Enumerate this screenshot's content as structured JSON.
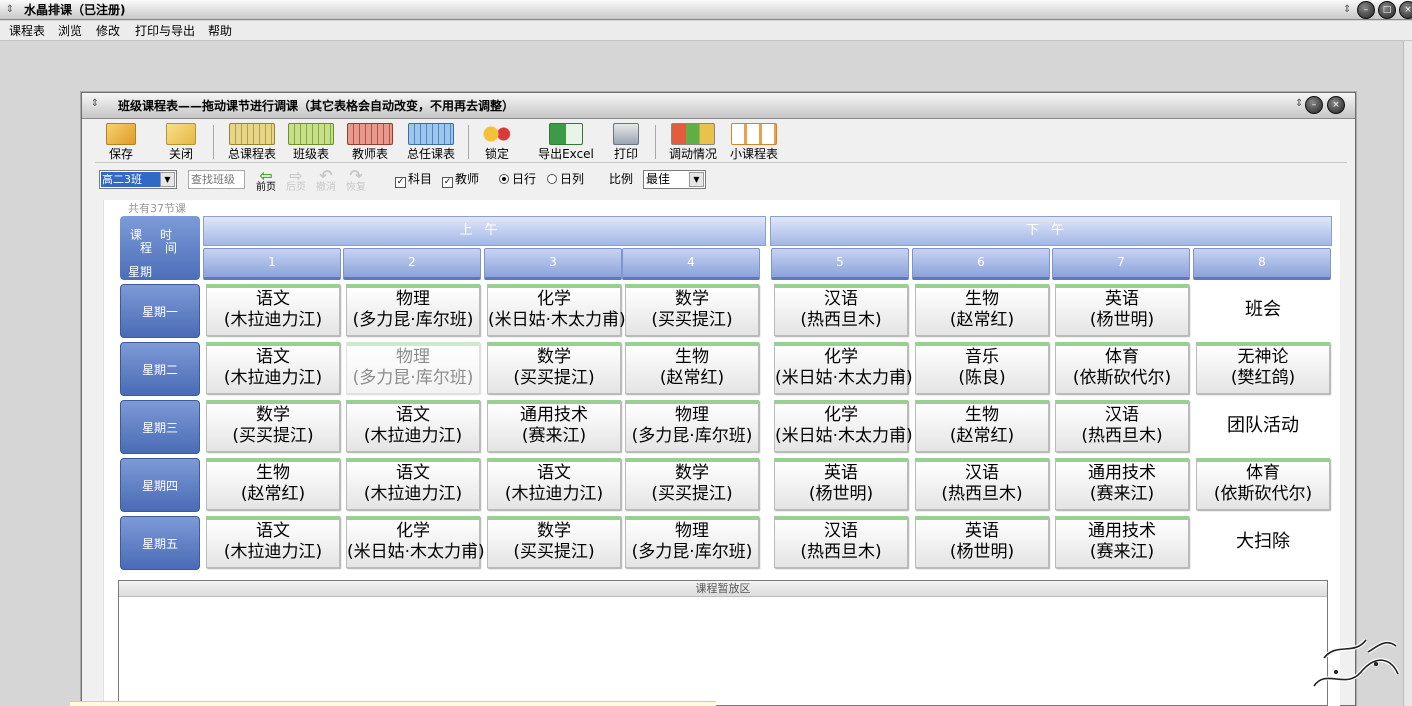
{
  "app": {
    "title": "水晶排课（已注册)"
  },
  "menu": [
    "课程表",
    "浏览",
    "修改",
    "打印与导出",
    "帮助"
  ],
  "window": {
    "title": "班级课程表——拖动课节进行调课（其它表格会自动改变，不用再去调整）"
  },
  "toolbar": {
    "save": "保存",
    "close": "关闭",
    "master": "总课程表",
    "class": "班级表",
    "teacher": "教师表",
    "head": "总任课表",
    "lock": "锁定",
    "excel": "导出Excel",
    "print": "打印",
    "adjust": "调动情况",
    "mini": "小课程表"
  },
  "options": {
    "class_value": "高二3班",
    "search_placeholder": "查找班级",
    "nav": [
      "前页",
      "后页",
      "撤消",
      "恢复"
    ],
    "chk_subject": "科目",
    "chk_teacher": "教师",
    "radio_row": "日行",
    "radio_col": "日列",
    "scale_label": "比例",
    "scale_value": "最佳"
  },
  "schedule": {
    "count": "共有37节课",
    "corner": {
      "a": "课",
      "b": "时",
      "c": "程",
      "d": "间",
      "e": "星期"
    },
    "morning": "上午",
    "afternoon": "下午",
    "periods": [
      "1",
      "2",
      "3",
      "4",
      "5",
      "6",
      "7",
      "8"
    ],
    "days": [
      {
        "name": "星期一",
        "lessons": [
          {
            "s": "语文",
            "t": "(木拉迪力江)"
          },
          {
            "s": "物理",
            "t": "(多力昆·库尔班)"
          },
          {
            "s": "化学",
            "t": "(米日姑·木太力甫)"
          },
          {
            "s": "数学",
            "t": "(买买提江)"
          },
          {
            "s": "汉语",
            "t": "(热西旦木)"
          },
          {
            "s": "生物",
            "t": "(赵常红)"
          },
          {
            "s": "英语",
            "t": "(杨世明)"
          },
          {
            "p": "班会"
          }
        ]
      },
      {
        "name": "星期二",
        "lessons": [
          {
            "s": "语文",
            "t": "(木拉迪力江)"
          },
          {
            "s": "物理",
            "t": "(多力昆·库尔班)",
            "ghost": true
          },
          {
            "s": "数学",
            "t": "(买买提江)"
          },
          {
            "s": "生物",
            "t": "(赵常红)"
          },
          {
            "s": "化学",
            "t": "(米日姑·木太力甫)"
          },
          {
            "s": "音乐",
            "t": "(陈良)"
          },
          {
            "s": "体育",
            "t": "(依斯砍代尔)"
          },
          {
            "s": "无神论",
            "t": "(樊红鸽)"
          }
        ]
      },
      {
        "name": "星期三",
        "lessons": [
          {
            "s": "数学",
            "t": "(买买提江)"
          },
          {
            "s": "语文",
            "t": "(木拉迪力江)"
          },
          {
            "s": "通用技术",
            "t": "(赛来江)"
          },
          {
            "s": "物理",
            "t": "(多力昆·库尔班)"
          },
          {
            "s": "化学",
            "t": "(米日姑·木太力甫)"
          },
          {
            "s": "生物",
            "t": "(赵常红)"
          },
          {
            "s": "汉语",
            "t": "(热西旦木)"
          },
          {
            "p": "团队活动"
          }
        ]
      },
      {
        "name": "星期四",
        "lessons": [
          {
            "s": "生物",
            "t": "(赵常红)"
          },
          {
            "s": "语文",
            "t": "(木拉迪力江)"
          },
          {
            "s": "语文",
            "t": "(木拉迪力江)"
          },
          {
            "s": "数学",
            "t": "(买买提江)"
          },
          {
            "s": "英语",
            "t": "(杨世明)"
          },
          {
            "s": "汉语",
            "t": "(热西旦木)"
          },
          {
            "s": "通用技术",
            "t": "(赛来江)"
          },
          {
            "s": "体育",
            "t": "(依斯砍代尔)"
          }
        ]
      },
      {
        "name": "星期五",
        "lessons": [
          {
            "s": "语文",
            "t": "(木拉迪力江)"
          },
          {
            "s": "化学",
            "t": "(米日姑·木太力甫)"
          },
          {
            "s": "数学",
            "t": "(买买提江)"
          },
          {
            "s": "物理",
            "t": "(多力昆·库尔班)"
          },
          {
            "s": "汉语",
            "t": "(热西旦木)"
          },
          {
            "s": "英语",
            "t": "(杨世明)"
          },
          {
            "s": "通用技术",
            "t": "(赛来江)"
          },
          {
            "p": "大扫除"
          }
        ]
      }
    ],
    "staging": "课程暂放区"
  },
  "colors": {
    "accent": "#4c6eb9",
    "lesson_stripe": "#97d090"
  }
}
